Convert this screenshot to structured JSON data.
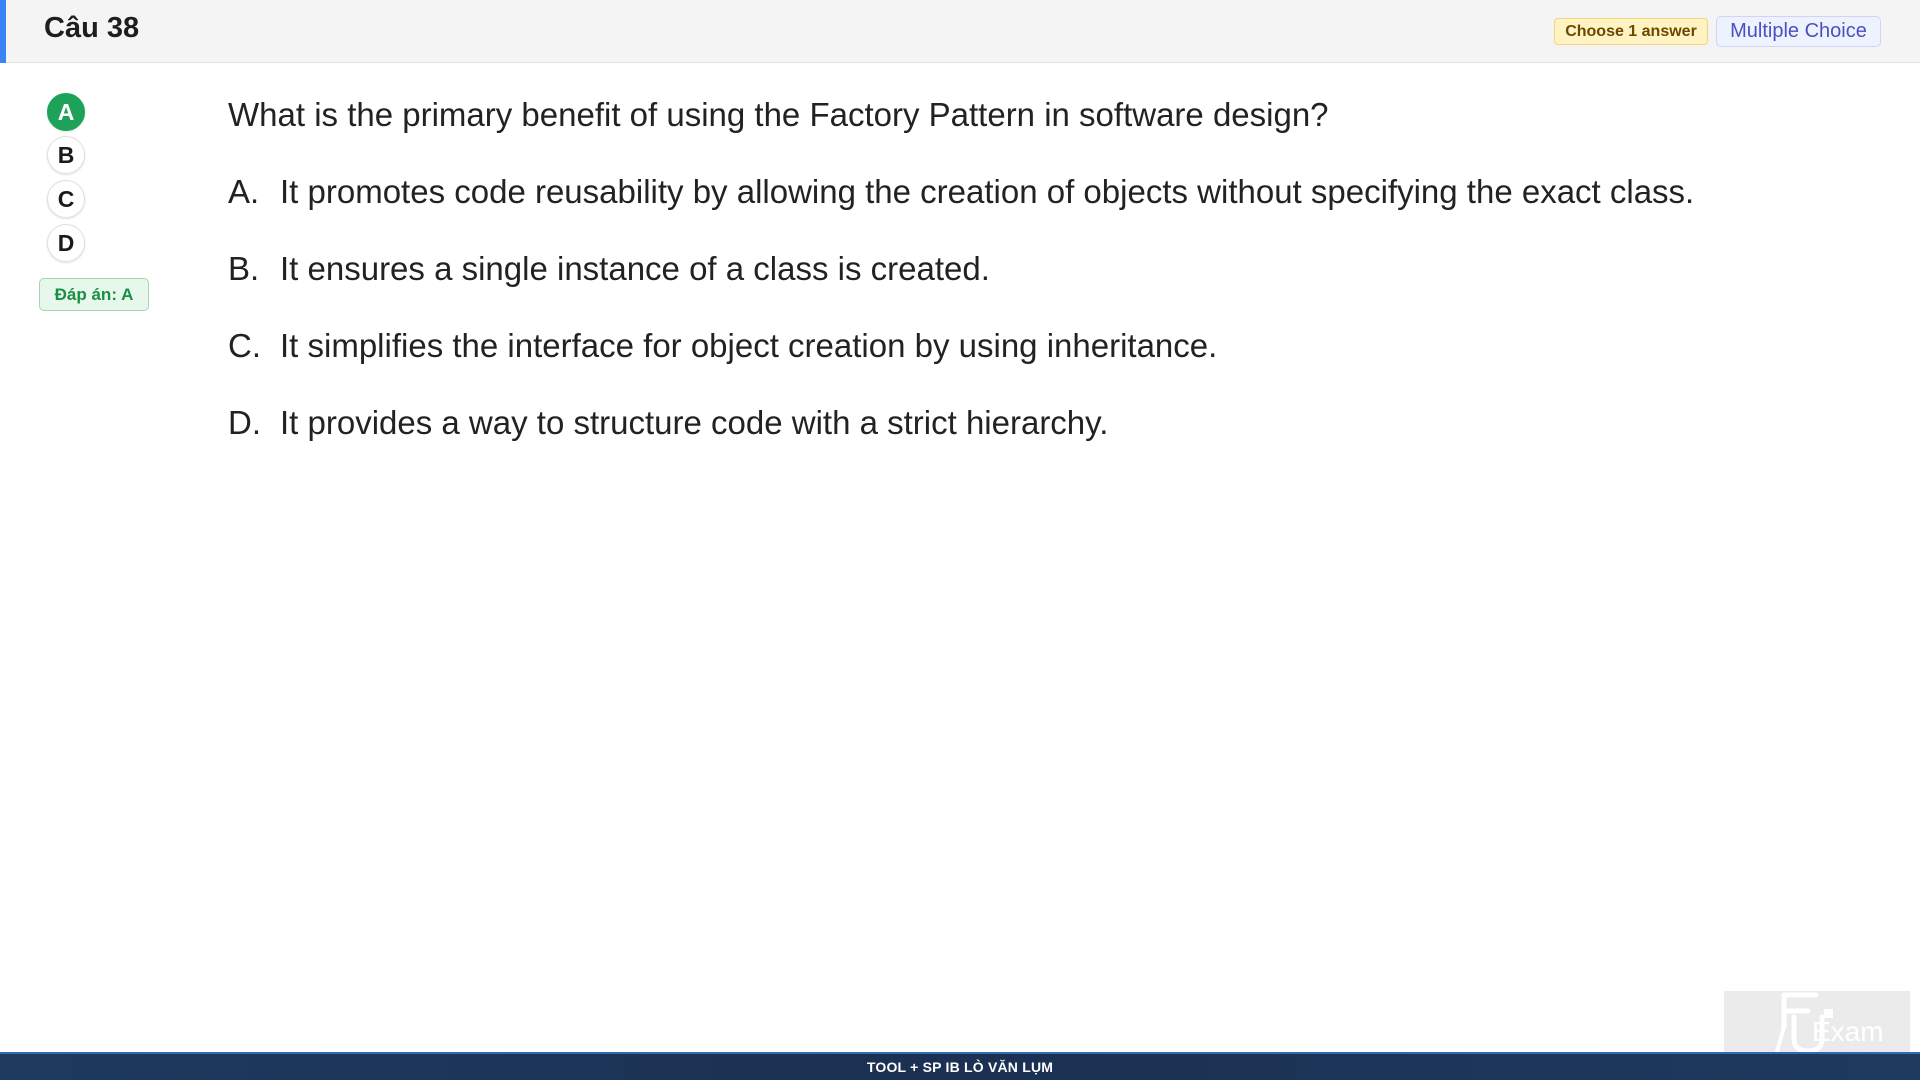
{
  "header": {
    "title": "Câu 38",
    "choose_label": "Choose 1 answer",
    "type_label": "Multiple Choice",
    "accent_color": "#3b82f6"
  },
  "sidebar": {
    "options": [
      {
        "letter": "A",
        "selected": true
      },
      {
        "letter": "B",
        "selected": false
      },
      {
        "letter": "C",
        "selected": false
      },
      {
        "letter": "D",
        "selected": false
      }
    ],
    "answer_label": "Đáp án: A",
    "selected_color": "#1ea25a"
  },
  "question": {
    "text": "What is the primary benefit of using the Factory Pattern in software design?",
    "choices": [
      {
        "letter": "A.",
        "text": "It promotes code reusability by allowing the creation of objects without specifying the exact class."
      },
      {
        "letter": "B.",
        "text": "It ensures a single instance of a class is created."
      },
      {
        "letter": "C.",
        "text": "It simplifies the interface for object creation by using inheritance."
      },
      {
        "letter": "D.",
        "text": "It provides a way to structure code with a strict hierarchy."
      }
    ]
  },
  "footer": {
    "text": "TOOL + SP IB LÒ VĂN LỤM"
  },
  "logo": {
    "icon": "fu-exam-logo",
    "text": "Exam"
  }
}
